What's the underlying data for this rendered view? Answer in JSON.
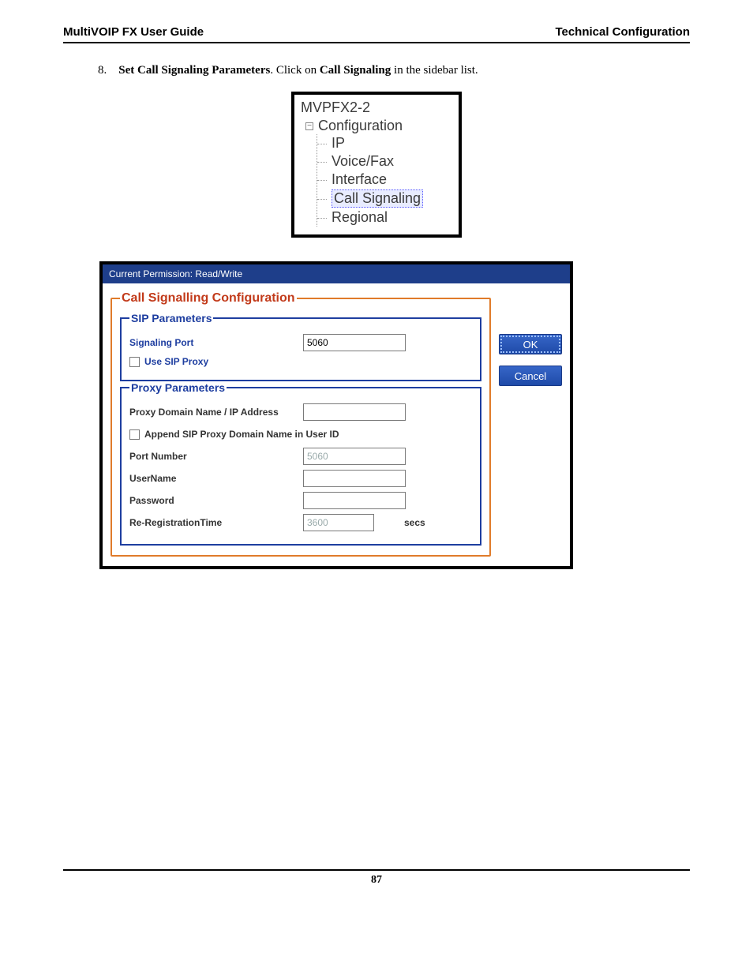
{
  "header": {
    "left": "MultiVOIP FX User Guide",
    "right": "Technical Configuration"
  },
  "step": {
    "number": "8.",
    "bold1": "Set Call Signaling Parameters",
    "mid": ".  Click on ",
    "bold2": "Call Signaling",
    "tail": " in the sidebar list."
  },
  "tree": {
    "root": "MVPFX2-2",
    "config": "Configuration",
    "items": [
      "IP",
      "Voice/Fax",
      "Interface",
      "Call Signaling",
      "Regional"
    ],
    "selected_index": 3
  },
  "dialog": {
    "titlebar": "Current Permission:  Read/Write",
    "outer_legend": "Call Signalling Configuration",
    "sip_legend": "SIP Parameters",
    "proxy_legend": "Proxy Parameters",
    "sip": {
      "signaling_port_label": "Signaling Port",
      "signaling_port_value": "5060",
      "use_sip_proxy_label": "Use SIP Proxy"
    },
    "proxy": {
      "domain_label": "Proxy Domain Name / IP Address",
      "domain_value": "",
      "append_label": "Append SIP Proxy Domain Name in User ID",
      "port_label": "Port Number",
      "port_value": "5060",
      "user_label": "UserName",
      "user_value": "",
      "pass_label": "Password",
      "pass_value": "",
      "rereg_label": "Re-RegistrationTime",
      "rereg_value": "3600",
      "rereg_unit": "secs"
    },
    "buttons": {
      "ok": "OK",
      "cancel": "Cancel"
    }
  },
  "footer": {
    "page": "87"
  }
}
